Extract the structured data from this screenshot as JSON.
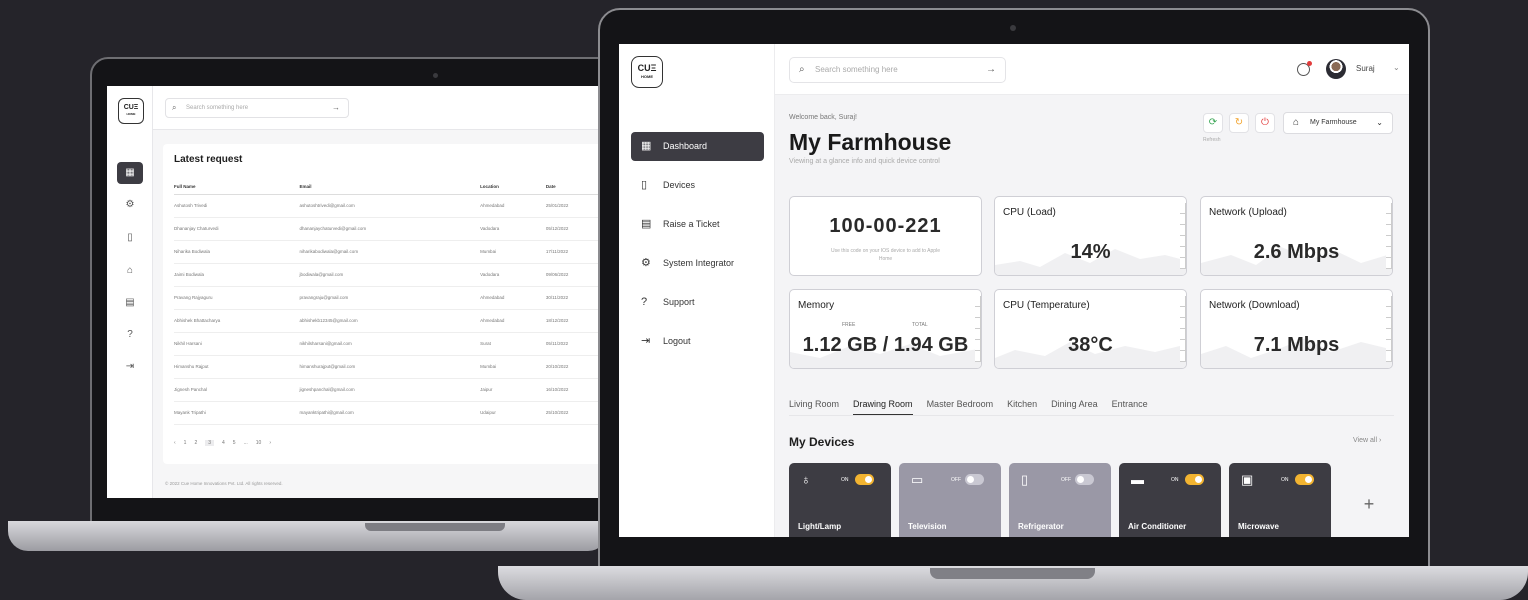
{
  "back": {
    "search_placeholder": "Search something here",
    "card_title": "Latest request",
    "columns": [
      "Full Name",
      "Email",
      "Location",
      "Date"
    ],
    "rows": [
      [
        "Ashutosh Trivedi",
        "ashutoshtrivedi@gmail.com",
        "Ahmedabad",
        "25/01/2022"
      ],
      [
        "Dhananjay Chaturvedi",
        "dhananjaychaturvedi@gmail.com",
        "Vadodara",
        "05/12/2022"
      ],
      [
        "Niharika Bodiwala",
        "niharikabodiwala@gmail.com",
        "Mumbai",
        "17/11/2022"
      ],
      [
        "Jaimi Bodiwala",
        "jbodiwala@gmail.com",
        "Vadodara",
        "09/06/2022"
      ],
      [
        "Pravang Rajyaguru",
        "pravangraju@gmail.com",
        "Ahmedabad",
        "30/11/2022"
      ],
      [
        "Abhishek Bhattacharya",
        "abhishekb12345@gmail.com",
        "Ahmedabad",
        "18/12/2022"
      ],
      [
        "Nikhil Harsani",
        "nikhilsharsani@gmail.com",
        "Surat",
        "05/11/2022"
      ],
      [
        "Himanshu Rajput",
        "himanshurajput@gmail.com",
        "Mumbai",
        "20/10/2022"
      ],
      [
        "Jignesh Panchal",
        "jigneshpanchal@gmail.com",
        "Jaipur",
        "16/10/2022"
      ],
      [
        "Mayank Tripathi",
        "mayanktripathi@gmail.com",
        "Udaipur",
        "25/10/2022"
      ]
    ],
    "pages": [
      "‹",
      "1",
      "2",
      "3",
      "4",
      "5",
      "...",
      "10",
      "›"
    ],
    "footer": "© 2022 Cue Home Innovations Pvt. Ltd. All rights reserved."
  },
  "logo": {
    "main": "CUΞ",
    "sub": "HOME"
  },
  "nav": [
    {
      "label": "Dashboard",
      "icon": "▦"
    },
    {
      "label": "Devices",
      "icon": "▯"
    },
    {
      "label": "Raise a Ticket",
      "icon": "▤"
    },
    {
      "label": "System Integrator",
      "icon": "⚙"
    },
    {
      "label": "Support",
      "icon": "?"
    },
    {
      "label": "Logout",
      "icon": "⇥"
    }
  ],
  "search": {
    "placeholder": "Search something here"
  },
  "user": {
    "name": "Suraj"
  },
  "welcome": "Welcome back, Suraj!",
  "title": "My Farmhouse",
  "subtitle": "Viewing at a glance info and quick device control",
  "refresh_label": "Refresh",
  "home_select": "My Farmhouse",
  "tiles": {
    "code": {
      "value": "100-00-221",
      "hint": "Use this code on your IOS device to add to Apple Home"
    },
    "cpu_load": {
      "label": "CPU (Load)",
      "value": "14%"
    },
    "net_up": {
      "label": "Network (Upload)",
      "value": "2.6 Mbps"
    },
    "memory": {
      "label": "Memory",
      "value": "1.12 GB / 1.94 GB",
      "free": "FREE",
      "total": "TOTAL"
    },
    "cpu_temp": {
      "label": "CPU (Temperature)",
      "value": "38°C"
    },
    "net_down": {
      "label": "Network (Download)",
      "value": "7.1 Mbps"
    }
  },
  "rooms": [
    "Living Room",
    "Drawing Room",
    "Master Bedroom",
    "Kitchen",
    "Dining Area",
    "Entrance"
  ],
  "devices_title": "My Devices",
  "view_all": "View all ›",
  "devices": [
    {
      "name": "Light/Lamp",
      "state": "ON",
      "icon": "♁"
    },
    {
      "name": "Television",
      "state": "OFF",
      "icon": "▭"
    },
    {
      "name": "Refrigerator",
      "state": "OFF",
      "icon": "▯"
    },
    {
      "name": "Air Conditioner",
      "state": "ON",
      "icon": "▬"
    },
    {
      "name": "Microwave",
      "state": "ON",
      "icon": "▣"
    }
  ],
  "add_symbol": "+"
}
